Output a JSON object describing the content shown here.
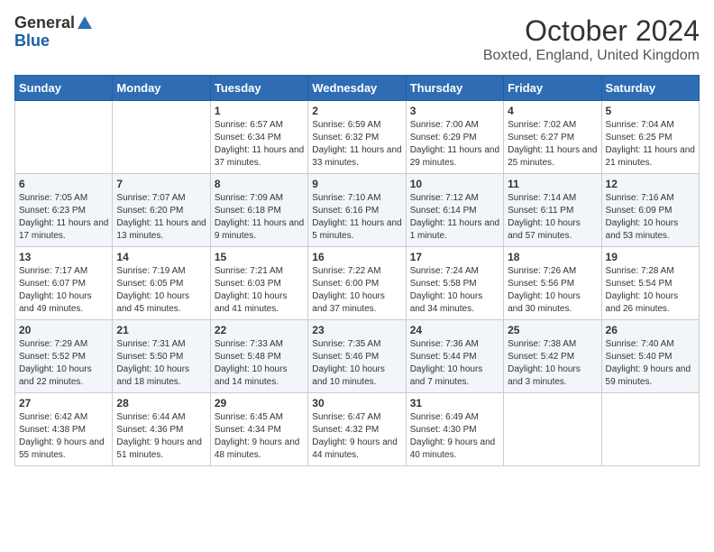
{
  "header": {
    "logo_general": "General",
    "logo_blue": "Blue",
    "month_title": "October 2024",
    "location": "Boxted, England, United Kingdom"
  },
  "weekdays": [
    "Sunday",
    "Monday",
    "Tuesday",
    "Wednesday",
    "Thursday",
    "Friday",
    "Saturday"
  ],
  "weeks": [
    [
      {
        "day": "",
        "info": ""
      },
      {
        "day": "",
        "info": ""
      },
      {
        "day": "1",
        "info": "Sunrise: 6:57 AM\nSunset: 6:34 PM\nDaylight: 11 hours and 37 minutes."
      },
      {
        "day": "2",
        "info": "Sunrise: 6:59 AM\nSunset: 6:32 PM\nDaylight: 11 hours and 33 minutes."
      },
      {
        "day": "3",
        "info": "Sunrise: 7:00 AM\nSunset: 6:29 PM\nDaylight: 11 hours and 29 minutes."
      },
      {
        "day": "4",
        "info": "Sunrise: 7:02 AM\nSunset: 6:27 PM\nDaylight: 11 hours and 25 minutes."
      },
      {
        "day": "5",
        "info": "Sunrise: 7:04 AM\nSunset: 6:25 PM\nDaylight: 11 hours and 21 minutes."
      }
    ],
    [
      {
        "day": "6",
        "info": "Sunrise: 7:05 AM\nSunset: 6:23 PM\nDaylight: 11 hours and 17 minutes."
      },
      {
        "day": "7",
        "info": "Sunrise: 7:07 AM\nSunset: 6:20 PM\nDaylight: 11 hours and 13 minutes."
      },
      {
        "day": "8",
        "info": "Sunrise: 7:09 AM\nSunset: 6:18 PM\nDaylight: 11 hours and 9 minutes."
      },
      {
        "day": "9",
        "info": "Sunrise: 7:10 AM\nSunset: 6:16 PM\nDaylight: 11 hours and 5 minutes."
      },
      {
        "day": "10",
        "info": "Sunrise: 7:12 AM\nSunset: 6:14 PM\nDaylight: 11 hours and 1 minute."
      },
      {
        "day": "11",
        "info": "Sunrise: 7:14 AM\nSunset: 6:11 PM\nDaylight: 10 hours and 57 minutes."
      },
      {
        "day": "12",
        "info": "Sunrise: 7:16 AM\nSunset: 6:09 PM\nDaylight: 10 hours and 53 minutes."
      }
    ],
    [
      {
        "day": "13",
        "info": "Sunrise: 7:17 AM\nSunset: 6:07 PM\nDaylight: 10 hours and 49 minutes."
      },
      {
        "day": "14",
        "info": "Sunrise: 7:19 AM\nSunset: 6:05 PM\nDaylight: 10 hours and 45 minutes."
      },
      {
        "day": "15",
        "info": "Sunrise: 7:21 AM\nSunset: 6:03 PM\nDaylight: 10 hours and 41 minutes."
      },
      {
        "day": "16",
        "info": "Sunrise: 7:22 AM\nSunset: 6:00 PM\nDaylight: 10 hours and 37 minutes."
      },
      {
        "day": "17",
        "info": "Sunrise: 7:24 AM\nSunset: 5:58 PM\nDaylight: 10 hours and 34 minutes."
      },
      {
        "day": "18",
        "info": "Sunrise: 7:26 AM\nSunset: 5:56 PM\nDaylight: 10 hours and 30 minutes."
      },
      {
        "day": "19",
        "info": "Sunrise: 7:28 AM\nSunset: 5:54 PM\nDaylight: 10 hours and 26 minutes."
      }
    ],
    [
      {
        "day": "20",
        "info": "Sunrise: 7:29 AM\nSunset: 5:52 PM\nDaylight: 10 hours and 22 minutes."
      },
      {
        "day": "21",
        "info": "Sunrise: 7:31 AM\nSunset: 5:50 PM\nDaylight: 10 hours and 18 minutes."
      },
      {
        "day": "22",
        "info": "Sunrise: 7:33 AM\nSunset: 5:48 PM\nDaylight: 10 hours and 14 minutes."
      },
      {
        "day": "23",
        "info": "Sunrise: 7:35 AM\nSunset: 5:46 PM\nDaylight: 10 hours and 10 minutes."
      },
      {
        "day": "24",
        "info": "Sunrise: 7:36 AM\nSunset: 5:44 PM\nDaylight: 10 hours and 7 minutes."
      },
      {
        "day": "25",
        "info": "Sunrise: 7:38 AM\nSunset: 5:42 PM\nDaylight: 10 hours and 3 minutes."
      },
      {
        "day": "26",
        "info": "Sunrise: 7:40 AM\nSunset: 5:40 PM\nDaylight: 9 hours and 59 minutes."
      }
    ],
    [
      {
        "day": "27",
        "info": "Sunrise: 6:42 AM\nSunset: 4:38 PM\nDaylight: 9 hours and 55 minutes."
      },
      {
        "day": "28",
        "info": "Sunrise: 6:44 AM\nSunset: 4:36 PM\nDaylight: 9 hours and 51 minutes."
      },
      {
        "day": "29",
        "info": "Sunrise: 6:45 AM\nSunset: 4:34 PM\nDaylight: 9 hours and 48 minutes."
      },
      {
        "day": "30",
        "info": "Sunrise: 6:47 AM\nSunset: 4:32 PM\nDaylight: 9 hours and 44 minutes."
      },
      {
        "day": "31",
        "info": "Sunrise: 6:49 AM\nSunset: 4:30 PM\nDaylight: 9 hours and 40 minutes."
      },
      {
        "day": "",
        "info": ""
      },
      {
        "day": "",
        "info": ""
      }
    ]
  ]
}
